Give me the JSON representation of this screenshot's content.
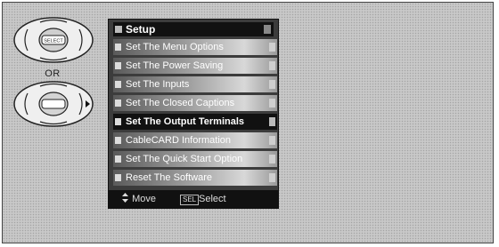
{
  "remote": {
    "select_key_label": "SELECT",
    "or_label": "OR"
  },
  "menu": {
    "title": "Setup",
    "items": [
      {
        "label": "Set The Menu Options"
      },
      {
        "label": "Set The Power Saving"
      },
      {
        "label": "Set The Inputs"
      },
      {
        "label": "Set The Closed Captions"
      },
      {
        "label": "Set The Output Terminals",
        "selected": true
      },
      {
        "label": "CableCARD Information"
      },
      {
        "label": "Set The Quick Start Option"
      },
      {
        "label": "Reset The Software"
      }
    ],
    "footer": {
      "move_label": "Move",
      "select_key": "SEL",
      "select_label": "Select"
    }
  }
}
